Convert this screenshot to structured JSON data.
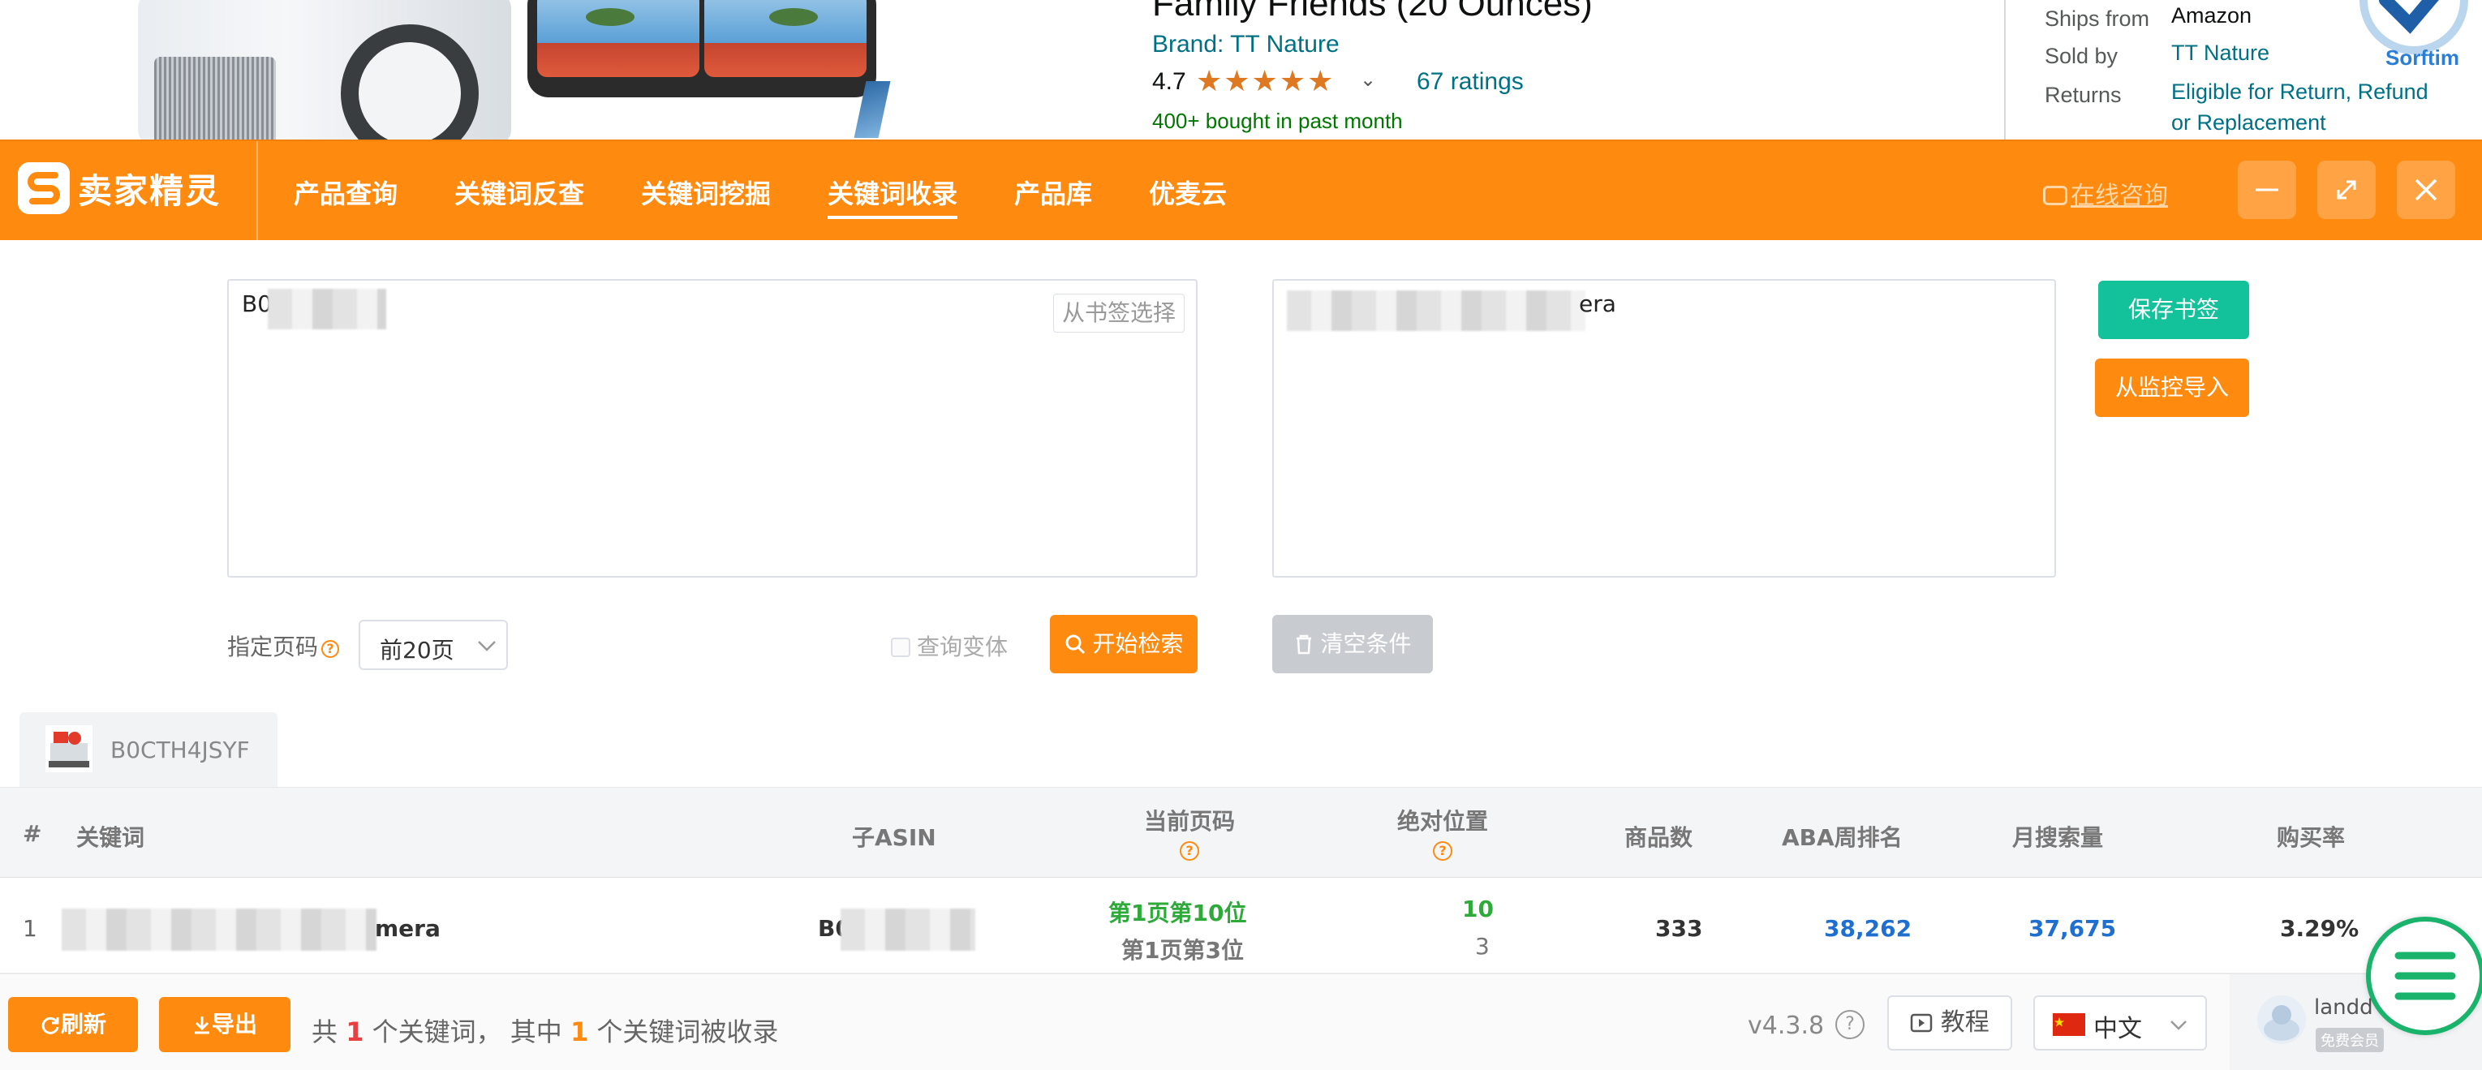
{
  "amazon": {
    "title_partial": "Family Friends (20 Ounces)",
    "brand": "Brand: TT Nature",
    "rating_value": "4.7",
    "stars": "★★★★★",
    "ratings_count": "67 ratings",
    "bought": "400+ bought in past month",
    "buybox": {
      "ships_from_label": "Ships from",
      "ships_from_value": "Amazon",
      "sold_by_label": "Sold by",
      "sold_by_value": "TT Nature",
      "returns_label": "Returns",
      "returns_value": "Eligible for Return, Refund or Replacement"
    },
    "sorftime_label": "Sorftim"
  },
  "header": {
    "logo": "卖家精灵",
    "nav": [
      {
        "label": "产品查询"
      },
      {
        "label": "关键词反查"
      },
      {
        "label": "关键词挖掘"
      },
      {
        "label": "关键词收录"
      },
      {
        "label": "产品库"
      },
      {
        "label": "优麦云"
      }
    ],
    "active_nav": "关键词收录",
    "consult": "在线咨询"
  },
  "search": {
    "asin_input_prefix": "B0",
    "bookmark_select": "从书签选择",
    "keyword_input_suffix": "era",
    "save_bookmark": "保存书签",
    "import_monitor": "从监控导入",
    "page_label": "指定页码",
    "page_value": "前20页",
    "variant_label": "查询变体",
    "start_search": "开始检索",
    "clear": "清空条件"
  },
  "asin_tab": {
    "label": "B0CTH4JSYF"
  },
  "table": {
    "headers": {
      "index": "#",
      "keyword": "关键词",
      "child_asin": "子ASIN",
      "current_page": "当前页码",
      "absolute_position": "绝对位置",
      "product_count": "商品数",
      "aba_rank": "ABA周排名",
      "monthly_search": "月搜索量",
      "purchase_rate": "购买率"
    },
    "rows": [
      {
        "index": "1",
        "keyword_suffix": "mera",
        "child_asin_prefix": "B0",
        "page_line1": "第1页第10位",
        "page_line2": "第1页第3位",
        "abs_line1": "10",
        "abs_line2": "3",
        "product_count": "333",
        "aba_rank": "38,262",
        "monthly_search": "37,675",
        "purchase_rate": "3.29%"
      }
    ]
  },
  "footer": {
    "refresh": "刷新",
    "export": "导出",
    "summary_prefix": "共",
    "summary_total": "1",
    "summary_mid": "个关键词， 其中",
    "summary_indexed": "1",
    "summary_suffix": "个关键词被收录",
    "version": "v4.3.8",
    "tutorial": "教程",
    "language": "中文",
    "username": "landd",
    "member_badge": "免费会员"
  },
  "colors": {
    "brand_orange": "#ff8a10",
    "green_button": "#13c29a",
    "link_blue": "#1e6fd0",
    "page_green": "#2eaa3a"
  }
}
